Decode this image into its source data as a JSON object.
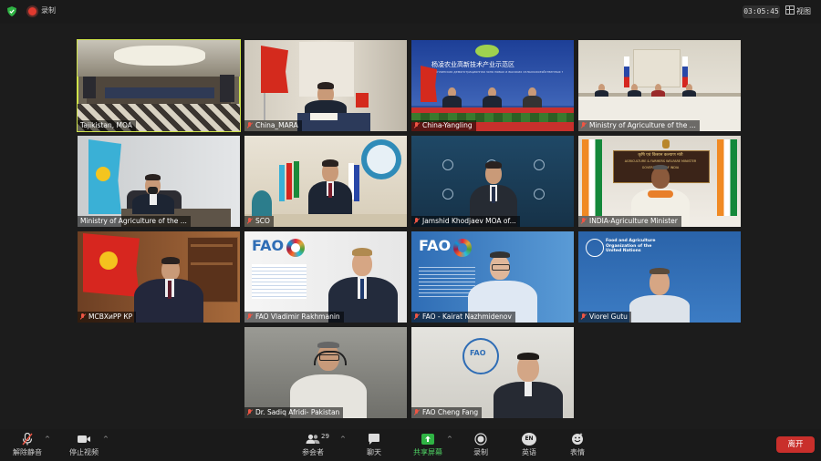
{
  "topbar": {
    "recording_label": "录制",
    "timer": "03:05:45",
    "view_label": "视图"
  },
  "tiles": [
    {
      "name": "Tajikistan, MOA",
      "muted": false,
      "active": true
    },
    {
      "name": "China_MARA",
      "muted": true
    },
    {
      "name": "China-Yangling",
      "muted": true
    },
    {
      "name": "Ministry of Agriculture of the ...",
      "muted": true
    },
    {
      "name": "Ministry of Agriculture of the ...",
      "muted": false
    },
    {
      "name": "SCO",
      "muted": true
    },
    {
      "name": "Jamshid Khodjaev MOA of...",
      "muted": true
    },
    {
      "name": "INDIA-Agriculture Minister",
      "muted": true
    },
    {
      "name": "МСВХиРР КР",
      "muted": true
    },
    {
      "name": "FAO Vladimir Rakhmanin",
      "muted": true
    },
    {
      "name": "FAO - Kairat Nazhmidenov",
      "muted": true
    },
    {
      "name": "Viorel Gutu",
      "muted": true
    },
    {
      "name": "Dr. Sadiq Afridi- Pakistan",
      "muted": true
    },
    {
      "name": "FAO Cheng Fang",
      "muted": true
    }
  ],
  "scene_text": {
    "yangling_banner": "杨凌农业高新技术产业示范区",
    "yangling_banner_sub": "Янлинская демонстрационная зона новых и высоких сельскохозяйственных технологий",
    "fao_logo": "FAO",
    "fao_org_1": "Food and Agriculture",
    "fao_org_2": "Organization of the",
    "fao_org_3": "United Nations",
    "india_banner": "कृषि एवं किसान कल्याण मंत्री",
    "india_banner_2": "AGRICULTURE & FARMERS WELFARE MINISTER",
    "india_banner_3": "GOVERNMENT OF INDIA"
  },
  "toolbar": {
    "unmute": "解除静音",
    "stop_video": "停止视频",
    "participants": "参会者",
    "participants_count": "29",
    "chat": "聊天",
    "share_screen": "共享屏幕",
    "record": "录制",
    "language": "英语",
    "language_badge": "EN",
    "reactions": "表情",
    "leave": "离开"
  },
  "colors": {
    "active_border": "#cfe34a",
    "share_green": "#2fb344",
    "leave_red": "#c92f2b",
    "record_red": "#e03a2f"
  }
}
